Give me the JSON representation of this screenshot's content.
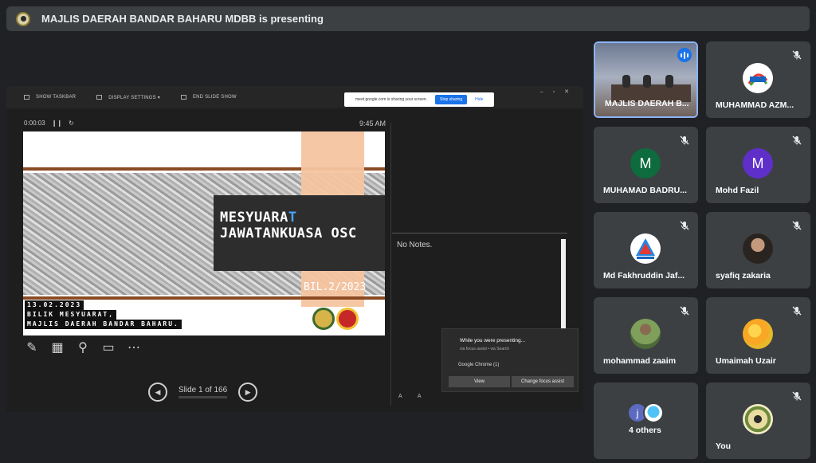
{
  "banner": {
    "presenter_text": "MAJLIS DAERAH BANDAR BAHARU MDBB is presenting"
  },
  "slideshow": {
    "toolbar": {
      "show_taskbar": "SHOW TASKBAR",
      "display_settings": "DISPLAY SETTINGS ▾",
      "end_slide_show": "END SLIDE SHOW"
    },
    "share_bar": {
      "message": "meet.google.com is sharing your screen.",
      "stop_label": "Stop sharing",
      "hide_label": "Hide"
    },
    "timer": "0:00:03",
    "clock": "9:45 AM",
    "slide": {
      "title_line1_main": "MESYUARA",
      "title_line1_accent": "T",
      "title_line2": "JAWATANKUASA OSC",
      "number": "BIL.2/2023",
      "date": "13.02.2023",
      "room": "BILIK MESYUARAT,",
      "org": "MAJLIS DAERAH BANDAR BAHARU."
    },
    "slide_counter": "Slide 1 of 166",
    "notes": "No Notes.",
    "font_buttons": "A A"
  },
  "focus_assist": {
    "heading": "While you were presenting...",
    "sub": "via focus assist • via Search",
    "app": "Google Chrome (1)",
    "view_label": "View",
    "change_label": "Change focus assist"
  },
  "participants": [
    {
      "name": "MAJLIS DAERAH B...",
      "type": "video",
      "speaking": true
    },
    {
      "name": "MUHAMMAD AZM...",
      "type": "logo",
      "logo": "SWCorp",
      "muted": true
    },
    {
      "name": "MUHAMAD BADRU...",
      "type": "initial",
      "initial": "M",
      "color": "#0d6b3e",
      "muted": true
    },
    {
      "name": "Mohd Fazil",
      "type": "initial",
      "initial": "M",
      "color": "#5f2fc9",
      "muted": true
    },
    {
      "name": "Md Fakhruddin Jaf...",
      "type": "logo",
      "logo": "MCMC",
      "muted": true
    },
    {
      "name": "syafiq zakaria",
      "type": "photo",
      "muted": true
    },
    {
      "name": "mohammad zaaim",
      "type": "photo",
      "muted": true
    },
    {
      "name": "Umaimah Uzair",
      "type": "photo",
      "muted": true
    },
    {
      "name": "4 others",
      "type": "others",
      "initial": "j"
    },
    {
      "name": "You",
      "type": "logo",
      "muted": true
    }
  ],
  "colors": {
    "accent": "#8ab4f8",
    "tile_bg": "#3c4043",
    "page_bg": "#202124",
    "speaking": "#1a73e8"
  }
}
